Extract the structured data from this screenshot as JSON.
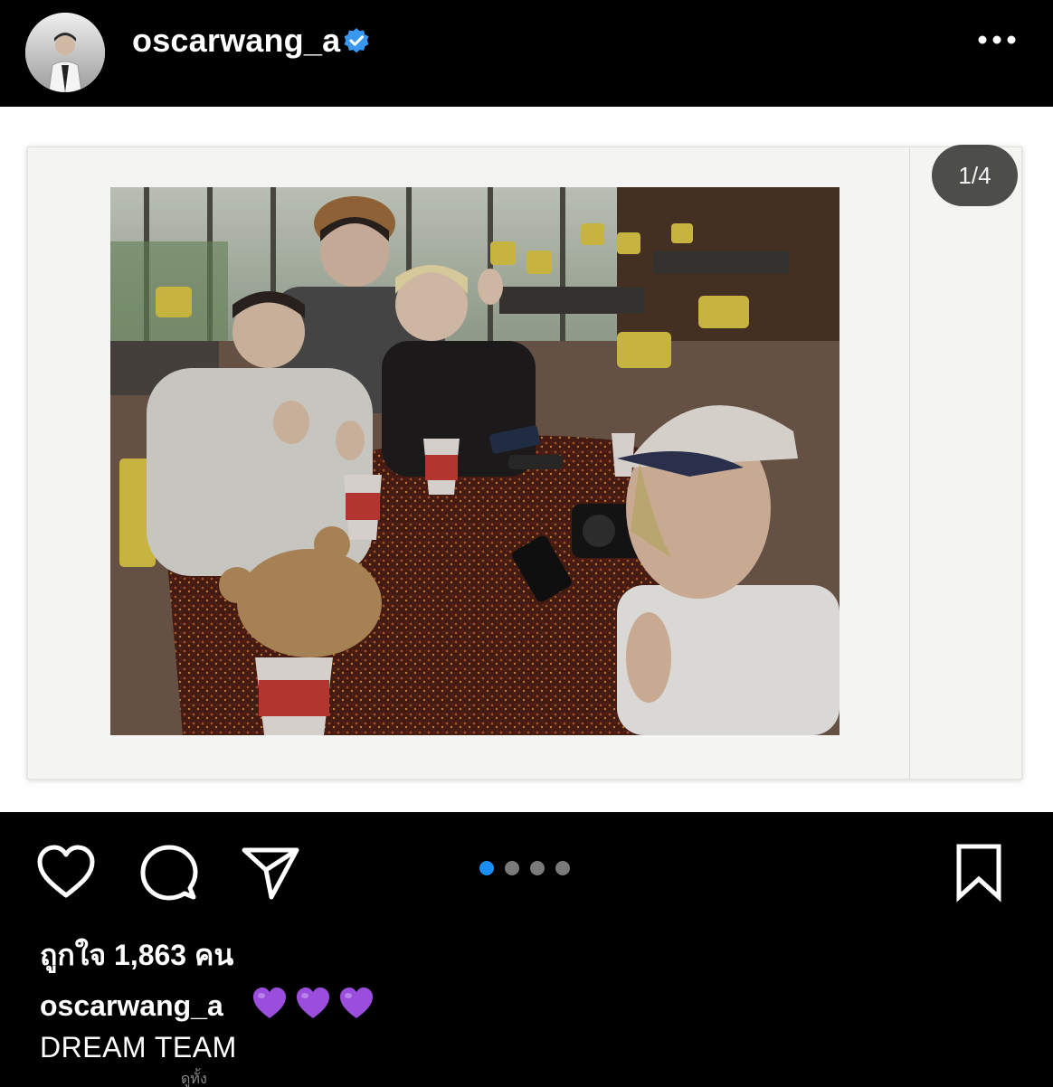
{
  "header": {
    "username": "oscarwang_a",
    "verified": true,
    "avatar_icon": "profile-photo",
    "more_icon": "more-horizontal-icon"
  },
  "post": {
    "slide_counter": "1/4",
    "slide_count": 4,
    "active_slide": 0,
    "photo_description_icon": "polaroid-photo"
  },
  "actions": {
    "like_icon": "heart-outline-icon",
    "comment_icon": "comment-bubble-icon",
    "share_icon": "paper-plane-icon",
    "save_icon": "bookmark-icon"
  },
  "likes_text": "ถูกใจ 1,863 คน",
  "caption": {
    "username": "oscarwang_a",
    "emoji": "💜💜💜",
    "text": "DREAM TEAM"
  },
  "footer_partial": "ดูทั้ง",
  "colors": {
    "background": "#000000",
    "accent_blue": "#1c8df2",
    "verified_blue": "#3897f0",
    "heart_purple": "#9b4dde"
  }
}
